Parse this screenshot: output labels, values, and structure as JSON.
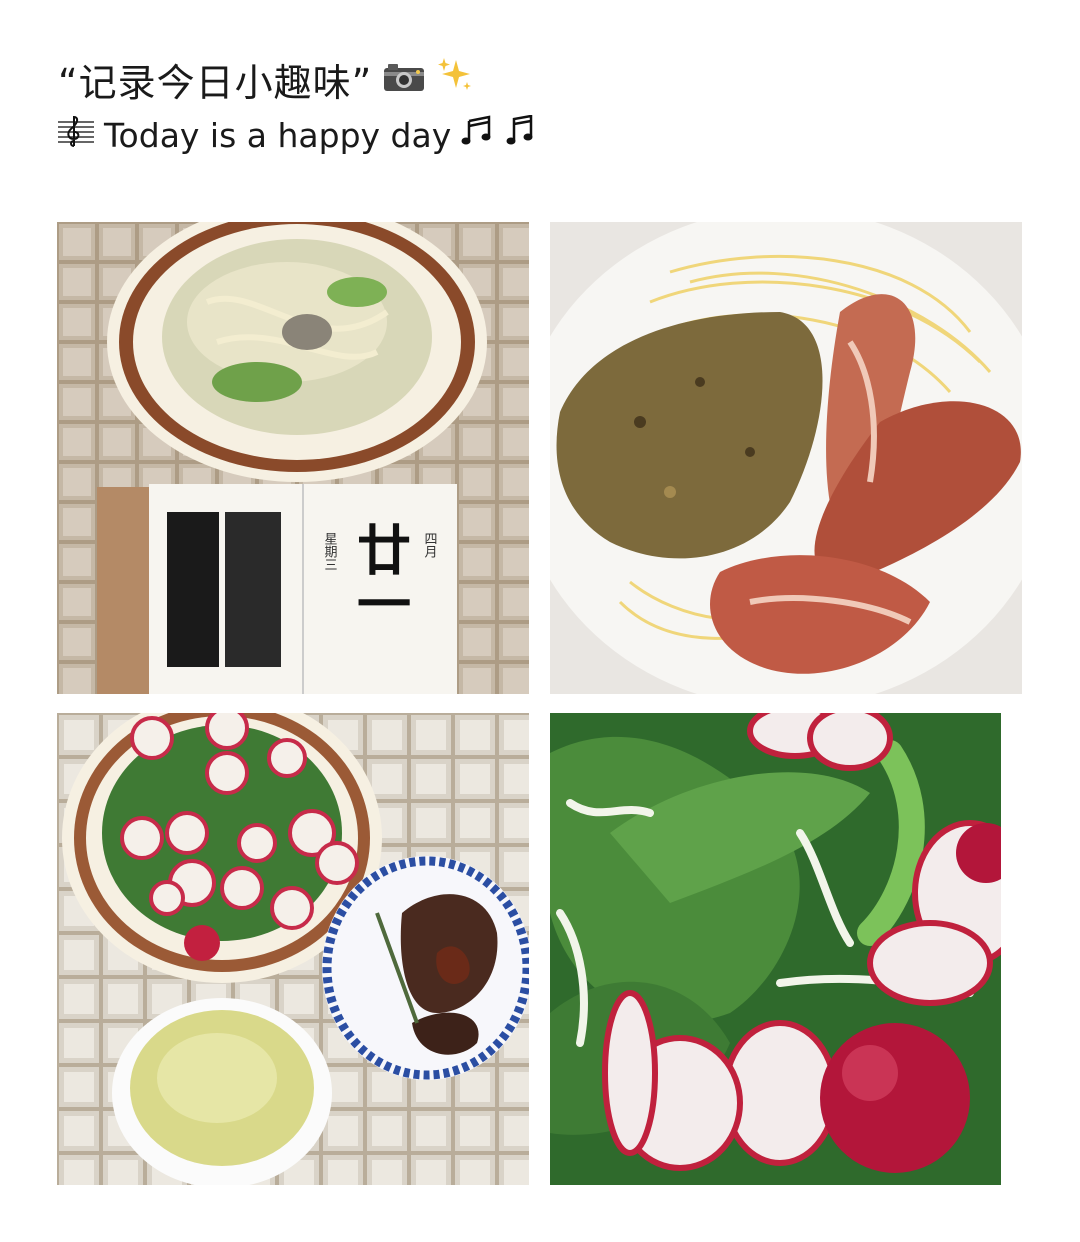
{
  "header": {
    "title": "“记录今日小趣味”",
    "title_icons": [
      "camera-icon",
      "sparkles-icon"
    ],
    "subtitle": "Today is a happy day",
    "subtitle_icons": [
      "treble-clef-icon",
      "notes-icon",
      "note-icon"
    ]
  },
  "photos": [
    {
      "name": "noodle-soup-and-calendar-photo"
    },
    {
      "name": "pasta-with-bacon-photo"
    },
    {
      "name": "radish-salad-steak-soup-photo"
    },
    {
      "name": "radish-salad-closeup-photo"
    }
  ],
  "calendar": {
    "weekday": "星期三",
    "month": "四月",
    "day": "廿一"
  }
}
